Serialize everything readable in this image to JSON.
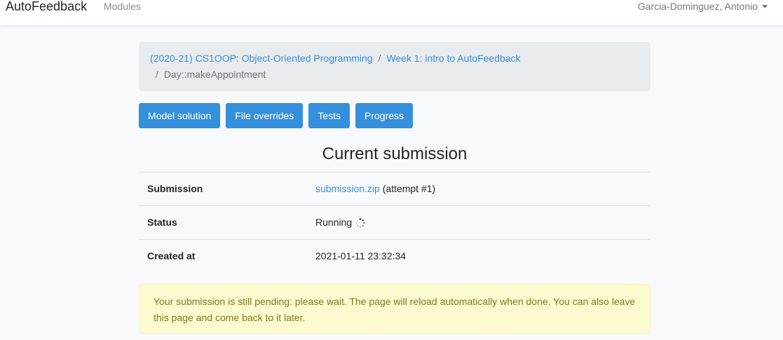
{
  "navbar": {
    "brand": "AutoFeedback",
    "modules_link": "Modules",
    "user": "Garcia-Dominguez, Antonio"
  },
  "breadcrumb": {
    "items": [
      "(2020-21) CS1OOP: Object-Oriented Programming",
      "Week 1: intro to AutoFeedback",
      "Day::makeAppointment"
    ],
    "separator": "/"
  },
  "actions": {
    "model_solution": "Model solution",
    "file_overrides": "File overrides",
    "tests": "Tests",
    "progress": "Progress"
  },
  "submission": {
    "heading": "Current submission",
    "rows": {
      "submission_label": "Submission",
      "file_link": "submission.zip",
      "attempt": "(attempt #1)",
      "status_label": "Status",
      "status_value": "Running",
      "status_icon": "spinner-icon",
      "created_label": "Created at",
      "created_value": "2021-01-11 23:32:34"
    }
  },
  "alert": {
    "message": "Your submission is still pending: please wait. The page will reload automatically when done. You can also leave this page and come back to it later."
  },
  "colors": {
    "primary": "#3490dc",
    "alert_bg": "#fcfbd0",
    "alert_text": "#7d7a22"
  }
}
